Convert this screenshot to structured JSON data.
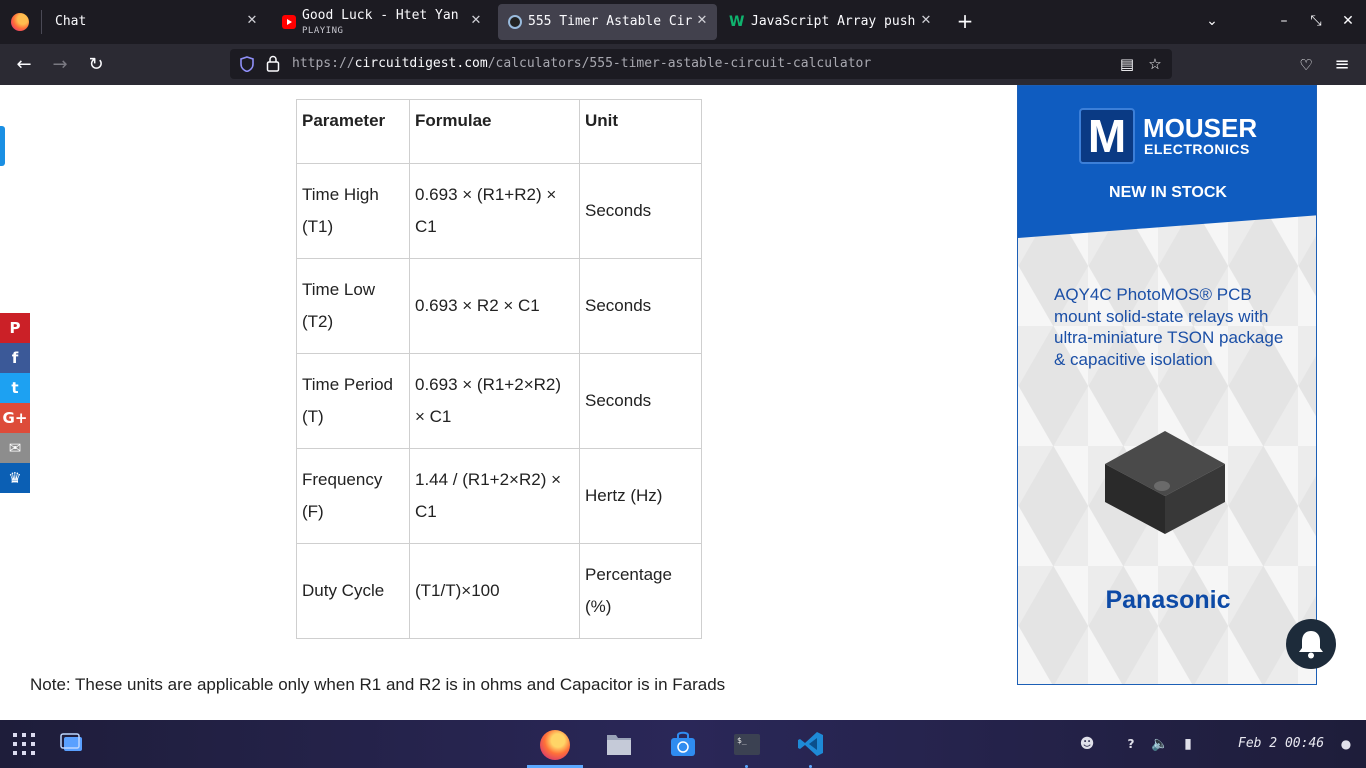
{
  "browser": {
    "tabs": [
      {
        "title": "Chat"
      },
      {
        "title": "Good Luck - Htet Yan",
        "sub": "PLAYING"
      },
      {
        "title": "555 Timer Astable Cir"
      },
      {
        "title": "JavaScript Array push"
      }
    ],
    "new_tab": "+",
    "url_prefix": "https://",
    "url_host": "circuitdigest.com",
    "url_path": "/calculators/555-timer-astable-circuit-calculator"
  },
  "table": {
    "headers": [
      "Parameter",
      "Formulae",
      "Unit"
    ],
    "rows": [
      {
        "parameter": "Time High (T1)",
        "formula": "0.693 × (R1+R2) × C1",
        "unit": "Seconds"
      },
      {
        "parameter": "Time Low (T2)",
        "formula": "0.693 × R2 × C1",
        "unit": "Seconds"
      },
      {
        "parameter": "Time Period (T)",
        "formula": "0.693 × (R1+2×R2) × C1",
        "unit": "Seconds"
      },
      {
        "parameter": "Frequency (F)",
        "formula": "1.44 / (R1+2×R2) × C1",
        "unit": "Hertz (Hz)"
      },
      {
        "parameter": "Duty Cycle",
        "formula": "(T1/T)×100",
        "unit": "Percentage (%)"
      }
    ]
  },
  "note": "Note: These units are applicable only when R1 and R2 is in ohms and Capacitor is in Farads",
  "share": [
    {
      "icon": "pinterest-icon",
      "glyph": "P",
      "color": "#cb2027"
    },
    {
      "icon": "facebook-icon",
      "glyph": "f",
      "color": "#3b5998"
    },
    {
      "icon": "twitter-icon",
      "glyph": "t",
      "color": "#1da1f2"
    },
    {
      "icon": "google-plus-icon",
      "glyph": "G+",
      "color": "#dd4b39"
    },
    {
      "icon": "email-icon",
      "glyph": "✉",
      "color": "#8d8d8d"
    },
    {
      "icon": "sumo-icon",
      "glyph": "♛",
      "color": "#0b5fb4"
    }
  ],
  "ad": {
    "logo_letter": "M",
    "brand": "MOUSER",
    "brand_sub": "ELECTRONICS",
    "tagline": "NEW IN STOCK",
    "body": "AQY4C PhotoMOS® PCB mount solid-state relays with ultra-miniature TSON package & capacitive isolation",
    "maker": "Panasonic"
  },
  "taskbar": {
    "clock": "Feb 2  00:46"
  }
}
